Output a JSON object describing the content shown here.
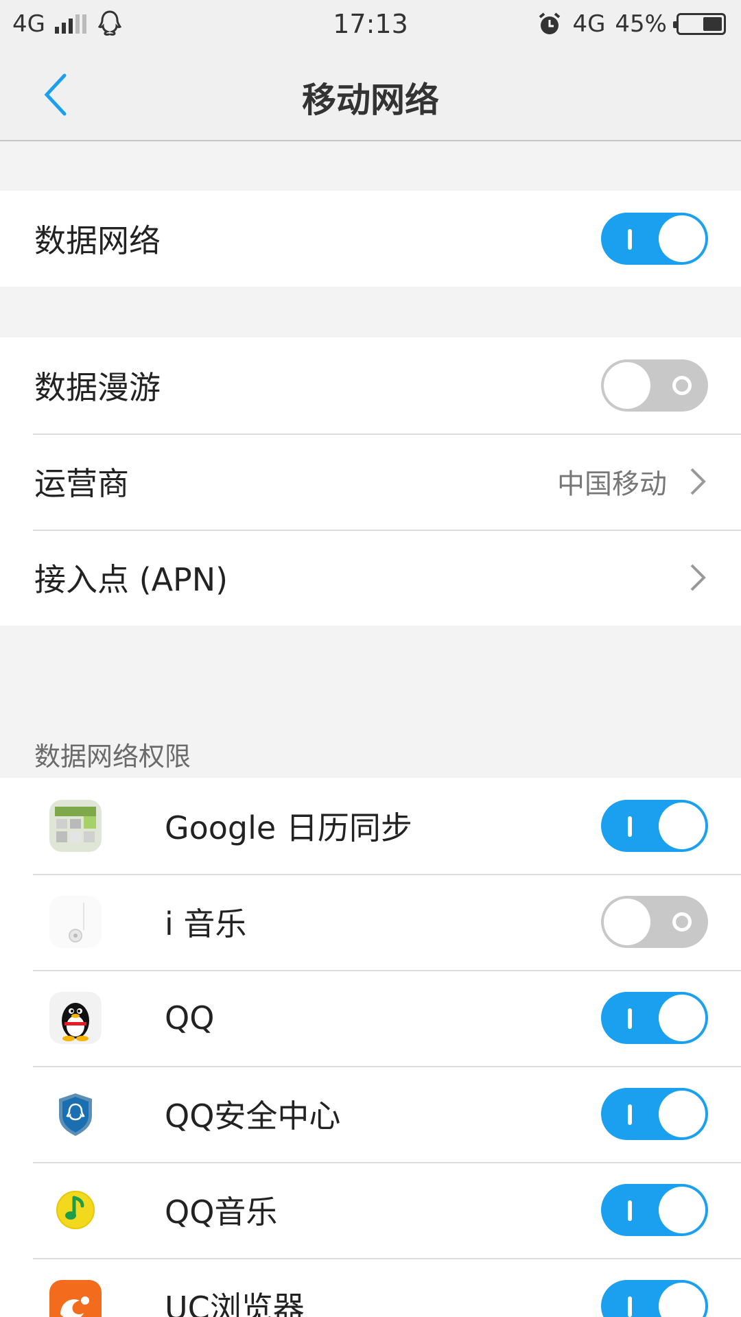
{
  "status_bar": {
    "network_left": "4G",
    "time": "17:13",
    "network_right": "4G",
    "battery_percent": "45%",
    "battery_level": 0.45
  },
  "nav": {
    "title": "移动网络"
  },
  "settings": {
    "data_network": {
      "label": "数据网络",
      "on": true
    },
    "data_roaming": {
      "label": "数据漫游",
      "on": false
    },
    "carrier": {
      "label": "运营商",
      "value": "中国移动"
    },
    "apn": {
      "label": "接入点 (APN)"
    }
  },
  "permissions": {
    "header": "数据网络权限",
    "apps": [
      {
        "name": "Google 日历同步",
        "icon": "google-calendar-sync-icon",
        "on": true
      },
      {
        "name": "i 音乐",
        "icon": "i-music-icon",
        "on": false
      },
      {
        "name": "QQ",
        "icon": "qq-penguin-icon",
        "on": true
      },
      {
        "name": "QQ安全中心",
        "icon": "qq-security-shield-icon",
        "on": true
      },
      {
        "name": "QQ音乐",
        "icon": "qq-music-icon",
        "on": true
      },
      {
        "name": "UC浏览器",
        "icon": "uc-browser-icon",
        "on": true
      }
    ]
  },
  "colors": {
    "accent": "#1aa0ee",
    "toggle_off": "#c8c8c8"
  }
}
